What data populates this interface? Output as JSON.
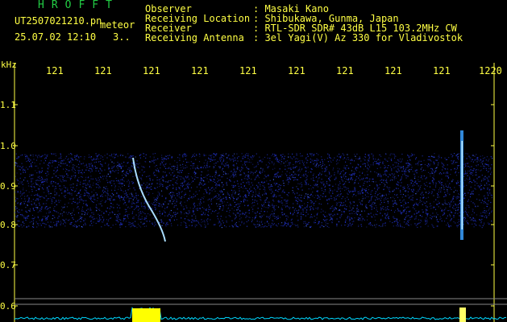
{
  "logo": "HROFFT",
  "filename": "UT2507021210.pn",
  "detection_tag": "meteor",
  "timestamp": "25.07.02 12:10",
  "counter": "3..",
  "header": [
    {
      "key": "Observer",
      "value": ": Masaki Kano"
    },
    {
      "key": "Receiving Location",
      "value": ": Shibukawa, Gunma, Japan"
    },
    {
      "key": "Receiver",
      "value": ": RTL-SDR SDR# 43dB L15 103.2MHz CW"
    },
    {
      "key": "Receiving Antenna",
      "value": ": 3el Yagi(V) Az 330 for Vladivostok"
    }
  ],
  "x_axis": {
    "unit": "kHz",
    "ticks": [
      "121",
      "121",
      "121",
      "121",
      "121",
      "121",
      "121",
      "121",
      "121",
      "1220"
    ]
  },
  "y_axis": {
    "ticks": [
      "1.1",
      "1.0",
      "0.9",
      "0.8",
      "0.7",
      "0.6"
    ]
  },
  "colors": {
    "text": "#ffff44",
    "logo": "#22cc44",
    "noise": "#2233cc",
    "trace": "#aaddff",
    "spectrum": "#00d8ff",
    "burst": "#ffff00"
  }
}
